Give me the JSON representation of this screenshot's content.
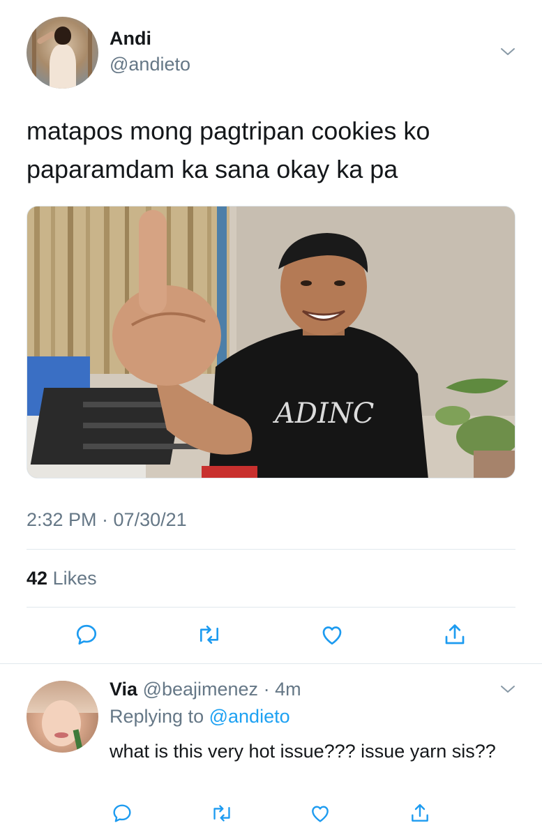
{
  "tweet": {
    "author": {
      "display_name": "Andi",
      "handle": "@andieto",
      "avatar_icon": "profile-photo"
    },
    "text": "matapos mong pagtripan cookies ko paparamdam ka sana okay ka pa",
    "media": {
      "type": "photo",
      "shirt_text": "ADINC"
    },
    "timestamp": "2:32 PM · 07/30/21",
    "likes": {
      "count": "42",
      "label": "Likes"
    },
    "actions": [
      "reply-icon",
      "retweet-icon",
      "like-icon",
      "share-icon"
    ]
  },
  "reply": {
    "author": {
      "display_name": "Via",
      "handle": "@beajimenez",
      "time": "· 4m"
    },
    "replying_to_label": "Replying to",
    "replying_to_handle": "@andieto",
    "text": "what is this very hot issue??? issue yarn sis??",
    "actions": [
      "reply-icon",
      "retweet-icon",
      "like-icon",
      "share-icon"
    ]
  },
  "colors": {
    "text_primary": "#14171a",
    "text_secondary": "#657786",
    "link": "#1da1f2",
    "divider": "#e1e8ed"
  }
}
